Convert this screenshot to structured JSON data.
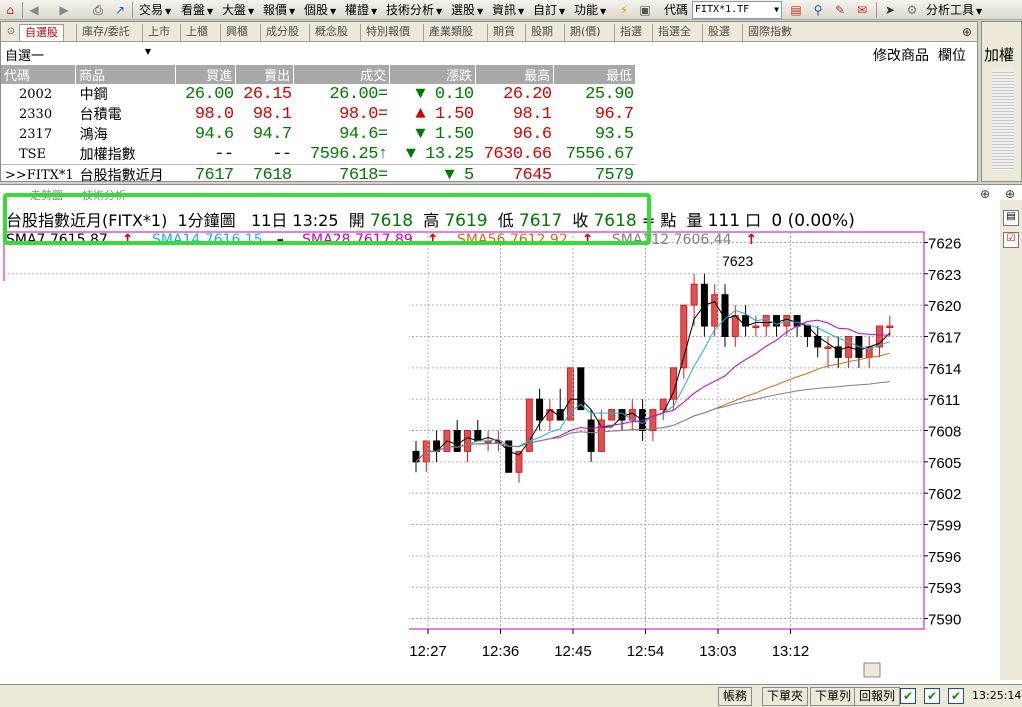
{
  "menubar": {
    "items": [
      "交易",
      "看盤",
      "大盤",
      "報價",
      "個股",
      "權證",
      "技術分析",
      "選股",
      "資訊",
      "自訂",
      "功能"
    ],
    "code_label": "代碼",
    "code_value": "FITX*1.TF",
    "analysis_tools": "分析工具"
  },
  "tabs": [
    "自選股",
    "庫存/委託",
    "上市",
    "上櫃",
    "興櫃",
    "成分股",
    "概念股",
    "特別報價",
    "產業類股",
    "期貨",
    "股期",
    "期(價)",
    "指選",
    "指選全",
    "股選",
    "國際指數"
  ],
  "quote": {
    "group": "自選一",
    "modify_label": "修改商品",
    "column_label": "欄位",
    "headers": [
      "代碼",
      "商品",
      "買進",
      "賣出",
      "成交",
      "漲跌",
      "最高",
      "最低"
    ],
    "rows": [
      {
        "code": "2002",
        "name": "中鋼",
        "bid": "26.00",
        "ask": "26.15",
        "last": "26.00=",
        "chg_arrow": "▼",
        "chg": "0.10",
        "high": "26.20",
        "low": "25.90"
      },
      {
        "code": "2330",
        "name": "台積電",
        "bid": "98.0",
        "ask": "98.1",
        "last": "98.0=",
        "chg_arrow": "▲",
        "chg": "1.50",
        "high": "98.1",
        "low": "96.7"
      },
      {
        "code": "2317",
        "name": "鴻海",
        "bid": "94.6",
        "ask": "94.7",
        "last": "94.6=",
        "chg_arrow": "▼",
        "chg": "1.50",
        "high": "96.6",
        "low": "93.5"
      },
      {
        "code": "TSE",
        "name": "加權指數",
        "bid": "--",
        "ask": "--",
        "last": "7596.25↑",
        "chg_arrow": "▼",
        "chg": "13.25",
        "high": "7630.66",
        "low": "7556.67"
      },
      {
        "code": ">>FITX*1",
        "name": "台股指數近月",
        "bid": "7617",
        "ask": "7618",
        "last": "7618=",
        "chg_arrow": "▼",
        "chg": "5",
        "high": "7645",
        "low": "7579"
      }
    ]
  },
  "side_panel": {
    "label": "加權"
  },
  "chart_tabs": [
    "走勢圖",
    "技術分析"
  ],
  "chart_header": {
    "name": "台股指數近月(FITX*1)",
    "period": "1分鐘圖",
    "date": "11日",
    "time": "13:25",
    "open_label": "開",
    "open": "7618",
    "high_label": "高",
    "high": "7619",
    "low_label": "低",
    "low": "7617",
    "close_label": "收",
    "close": "7618",
    "unit_label": "點",
    "vol_label": "量",
    "vol": "111",
    "lot_label": "口",
    "chg": "0 (0.00%)"
  },
  "ma": [
    {
      "label": "SMA7 7615.87",
      "color": "#000000"
    },
    {
      "label": "SMA14 7616.15",
      "color": "#1ab3d9"
    },
    {
      "label": "SMA28 7617.89",
      "color": "#c800c8"
    },
    {
      "label": "SMA56 7612.92",
      "color": "#d2691e"
    },
    {
      "label": "SMA112 7606.44",
      "color": "#808080"
    }
  ],
  "chart_data": {
    "type": "candlestick",
    "y_ticks": [
      7626,
      7623,
      7620,
      7617,
      7614,
      7611,
      7608,
      7605,
      7602,
      7599,
      7596,
      7593,
      7590
    ],
    "ylim": [
      7589,
      7627
    ],
    "x_ticks": [
      "12:27",
      "12:36",
      "12:45",
      "12:54",
      "13:03",
      "13:12"
    ],
    "peak_label": "7623",
    "candles": [
      [
        7606,
        7607,
        7604,
        7605
      ],
      [
        7605,
        7607,
        7604,
        7607
      ],
      [
        7607,
        7608,
        7605,
        7606
      ],
      [
        7606,
        7608,
        7606,
        7608
      ],
      [
        7608,
        7609,
        7606,
        7606
      ],
      [
        7606,
        7608,
        7605,
        7608
      ],
      [
        7608,
        7609,
        7607,
        7607
      ],
      [
        7607,
        7608,
        7606,
        7607
      ],
      [
        7607,
        7608,
        7606,
        7607
      ],
      [
        7607,
        7607,
        7604,
        7604
      ],
      [
        7604,
        7606,
        7603,
        7606
      ],
      [
        7606,
        7611,
        7606,
        7611
      ],
      [
        7611,
        7612,
        7608,
        7609
      ],
      [
        7609,
        7611,
        7608,
        7610
      ],
      [
        7610,
        7612,
        7609,
        7609
      ],
      [
        7609,
        7614,
        7609,
        7614
      ],
      [
        7614,
        7614,
        7610,
        7610
      ],
      [
        7609,
        7610,
        7605,
        7606
      ],
      [
        7606,
        7610,
        7606,
        7609
      ],
      [
        7609,
        7610,
        7609,
        7610
      ],
      [
        7610,
        7610,
        7608,
        7609
      ],
      [
        7609,
        7611,
        7608,
        7610
      ],
      [
        7610,
        7611,
        7607,
        7608
      ],
      [
        7608,
        7610,
        7607,
        7610
      ],
      [
        7610,
        7611,
        7609,
        7611
      ],
      [
        7611,
        7614,
        7610,
        7614
      ],
      [
        7614,
        7620,
        7613,
        7620
      ],
      [
        7620,
        7623,
        7618,
        7622
      ],
      [
        7622,
        7623,
        7617,
        7618
      ],
      [
        7618,
        7622,
        7617,
        7621
      ],
      [
        7621,
        7622,
        7616,
        7617
      ],
      [
        7617,
        7620,
        7616,
        7619
      ],
      [
        7619,
        7620,
        7617,
        7618
      ],
      [
        7618,
        7619,
        7617,
        7618
      ],
      [
        7618,
        7619,
        7617,
        7619
      ],
      [
        7619,
        7619,
        7617,
        7618
      ],
      [
        7618,
        7619,
        7617,
        7619
      ],
      [
        7619,
        7619,
        7617,
        7618
      ],
      [
        7618,
        7618,
        7616,
        7617
      ],
      [
        7617,
        7618,
        7615,
        7616
      ],
      [
        7616,
        7617,
        7614,
        7616
      ],
      [
        7616,
        7617,
        7614,
        7615
      ],
      [
        7615,
        7617,
        7614,
        7617
      ],
      [
        7617,
        7617,
        7614,
        7615
      ],
      [
        7615,
        7617,
        7614,
        7616
      ],
      [
        7616,
        7618,
        7615,
        7618
      ],
      [
        7618,
        7619,
        7617,
        7618
      ]
    ]
  },
  "bottombar": {
    "buttons": [
      "帳務",
      "下單夾",
      "下單列",
      "回報列"
    ],
    "clock": "13:25:14"
  }
}
